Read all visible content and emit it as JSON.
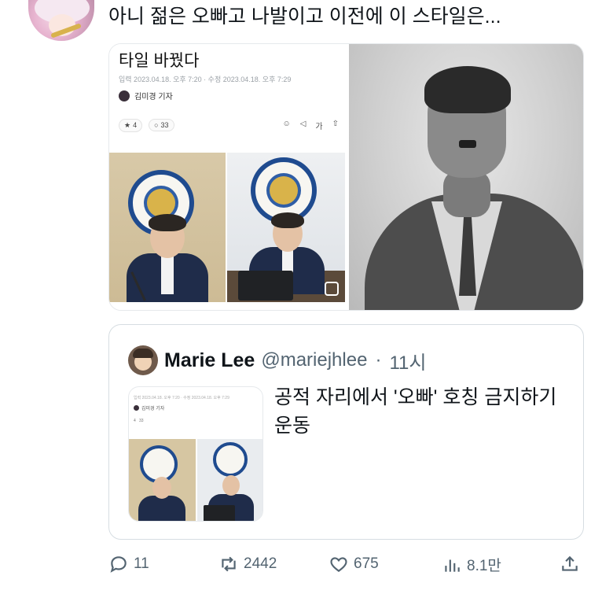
{
  "tweet": {
    "text": "아니 젊은 오빠고 나발이고 이전에 이 스타일은..."
  },
  "media_left": {
    "article_title": "타일 바꿨다",
    "article_meta": "입력 2023.04.18. 오후 7:20 · 수정 2023.04.18. 오후 7:29",
    "reporter": "김미경 기자",
    "reaction_count": "4",
    "comment_count": "33",
    "font_size_label": "가"
  },
  "quoted": {
    "name": "Marie Lee",
    "handle": "@mariejhlee",
    "separator": "·",
    "time": "11시",
    "text": "공적 자리에서 '오빠' 호칭 금지하기 운동",
    "mini_meta": "입력 2023.04.18. 오후 7:20 · 수정 2023.04.18. 오후 7:29",
    "mini_reporter": "김미경 기자",
    "mini_reaction": "4",
    "mini_comment": "33"
  },
  "actions": {
    "reply_count": "11",
    "retweet_count": "2442",
    "like_count": "675",
    "view_count": "8.1만"
  },
  "icons": {
    "reply": "reply-icon",
    "retweet": "retweet-icon",
    "like": "heart-icon",
    "views": "views-icon",
    "share": "share-icon"
  },
  "colors": {
    "text": "#0f1419",
    "secondary": "#536471",
    "border": "#d6dde2"
  }
}
